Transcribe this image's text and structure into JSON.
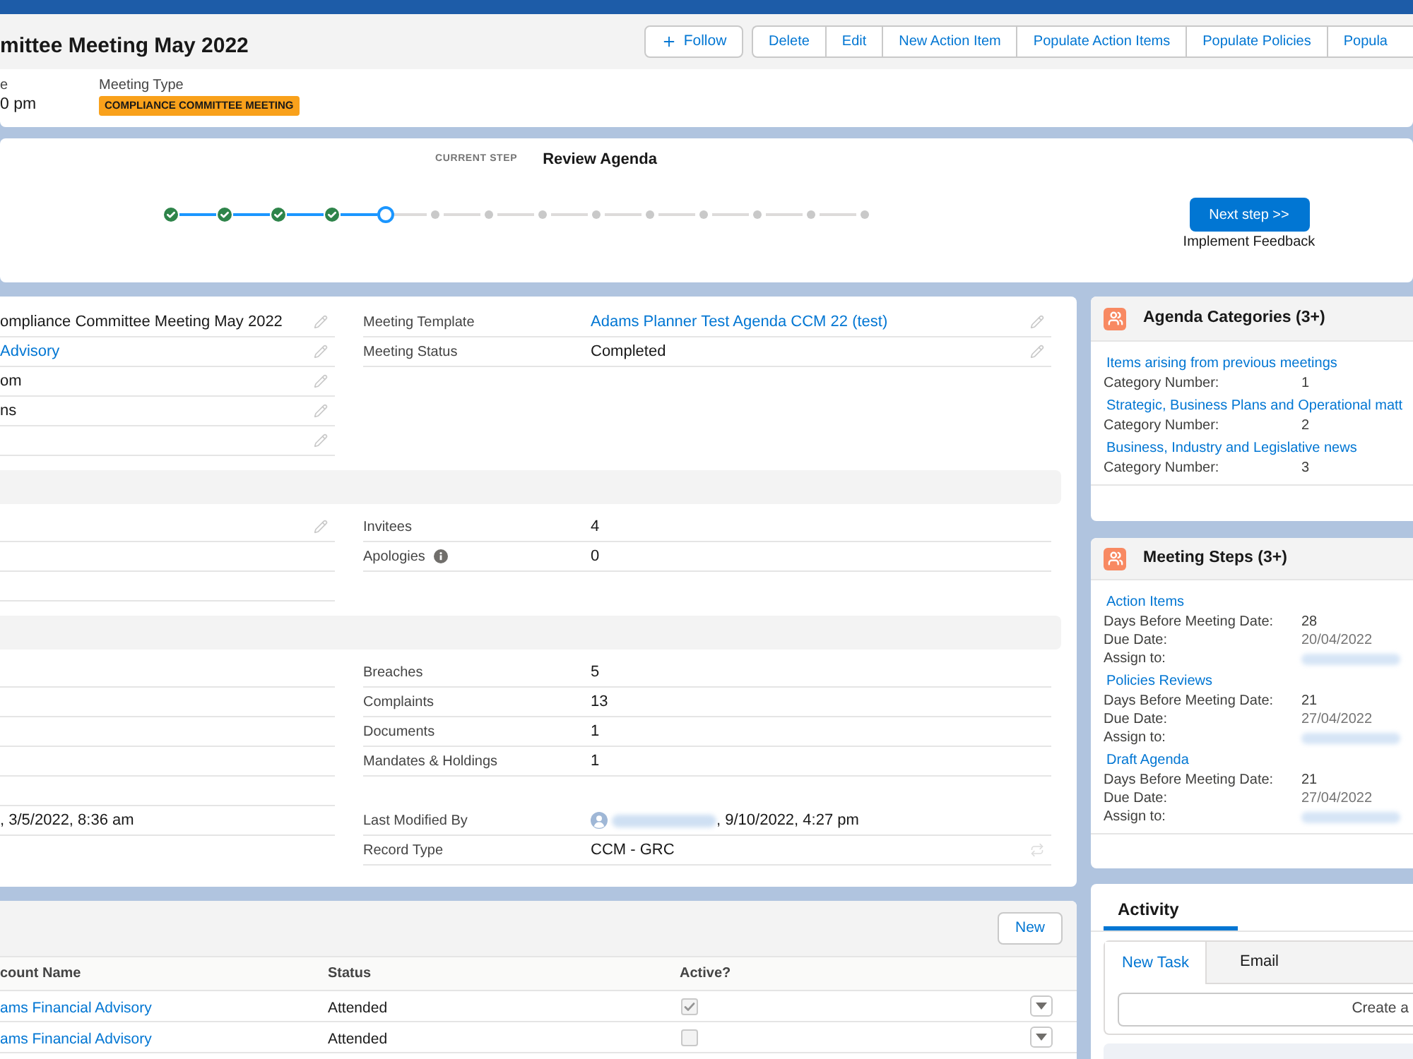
{
  "header": {
    "title": "mittee Meeting May 2022",
    "follow_button": "Follow",
    "action_buttons": [
      "Delete",
      "Edit",
      "New Action Item",
      "Populate Action Items",
      "Populate Policies",
      "Popula"
    ],
    "fields": [
      {
        "label": "e",
        "value": "0 pm",
        "kind": "text"
      },
      {
        "label": "Meeting Type",
        "value": "COMPLIANCE COMMITTEE MEETING",
        "kind": "badge"
      }
    ]
  },
  "path": {
    "current_step_label": "CURRENT STEP",
    "current_step": "Review Agenda",
    "steps": [
      {
        "completed": true,
        "current": false
      },
      {
        "completed": true,
        "current": false
      },
      {
        "completed": true,
        "current": false
      },
      {
        "completed": true,
        "current": false
      },
      {
        "completed": false,
        "current": true
      },
      {
        "completed": false,
        "current": false
      },
      {
        "completed": false,
        "current": false
      },
      {
        "completed": false,
        "current": false
      },
      {
        "completed": false,
        "current": false
      },
      {
        "completed": false,
        "current": false
      },
      {
        "completed": false,
        "current": false
      },
      {
        "completed": false,
        "current": false
      },
      {
        "completed": false,
        "current": false
      },
      {
        "completed": false,
        "current": false
      }
    ],
    "next_button": "Next step >>",
    "next_step": "Implement Feedback"
  },
  "details": {
    "sections": [
      {
        "kind": "block",
        "left": [
          {
            "kind": "text",
            "value": "ompliance Committee Meeting May 2022",
            "editable": true
          },
          {
            "kind": "link",
            "value": "Advisory",
            "editable": true
          },
          {
            "kind": "text",
            "value": "om",
            "editable": true
          },
          {
            "kind": "text",
            "value": "ns",
            "editable": true
          },
          {
            "kind": "empty",
            "editable": true
          }
        ],
        "right": [
          {
            "kind": "link",
            "label": "Meeting Template",
            "value": "Adams Planner Test Agenda CCM 22 (test)",
            "editable": true
          },
          {
            "kind": "text",
            "label": "Meeting Status",
            "value": "Completed",
            "editable": true
          }
        ]
      },
      {
        "kind": "section",
        "left": [
          {
            "kind": "empty",
            "editable": true
          },
          {
            "kind": "empty",
            "editable": false
          },
          {
            "kind": "empty",
            "editable": false
          }
        ],
        "right": [
          {
            "kind": "text",
            "label": "Invitees",
            "value": "4",
            "editable": false
          },
          {
            "kind": "text",
            "label": "Apologies",
            "has_info": true,
            "value": "0",
            "editable": false
          }
        ]
      },
      {
        "kind": "section",
        "left": [
          {
            "kind": "empty",
            "editable": false
          },
          {
            "kind": "empty",
            "editable": false
          },
          {
            "kind": "empty",
            "editable": false
          },
          {
            "kind": "empty",
            "editable": false
          }
        ],
        "right": [
          {
            "kind": "text",
            "label": "Breaches",
            "value": "5",
            "editable": false
          },
          {
            "kind": "text",
            "label": "Complaints",
            "value": "13",
            "editable": false
          },
          {
            "kind": "text",
            "label": "Documents",
            "value": "1",
            "editable": false
          },
          {
            "kind": "text",
            "label": "Mandates & Holdings",
            "value": "1",
            "editable": false
          }
        ]
      },
      {
        "kind": "block",
        "left": [
          {
            "kind": "empty",
            "editable": false
          },
          {
            "kind": "text",
            "value": ", 3/5/2022, 8:36 am",
            "editable": false
          }
        ],
        "right": [
          {
            "kind": "gap"
          },
          {
            "kind": "user",
            "label": "Last Modified By",
            "value": ", 9/10/2022, 4:27 pm",
            "editable": false
          },
          {
            "kind": "recordtype",
            "label": "Record Type",
            "value": "CCM - GRC",
            "editable": false
          }
        ]
      }
    ]
  },
  "related_list": {
    "new_button": "New",
    "columns": [
      "count Name",
      "Status",
      "Active?"
    ],
    "rows": [
      {
        "name": "ams Financial Advisory",
        "status": "Attended",
        "active": true
      },
      {
        "name": "ams Financial Advisory",
        "status": "Attended",
        "active": false
      }
    ]
  },
  "agenda_categories": {
    "title": "Agenda Categories (3+)",
    "items": [
      {
        "title": "Items arising from previous meetings",
        "fields": [
          {
            "label": "Category Number:",
            "value": "1",
            "kind": "text"
          }
        ]
      },
      {
        "title": "Strategic, Business Plans and Operational matt",
        "fields": [
          {
            "label": "Category Number:",
            "value": "2",
            "kind": "text"
          }
        ]
      },
      {
        "title": "Business, Industry and Legislative news",
        "fields": [
          {
            "label": "Category Number:",
            "value": "3",
            "kind": "text"
          }
        ]
      }
    ]
  },
  "meeting_steps": {
    "title": "Meeting Steps (3+)",
    "items": [
      {
        "title": "Action Items",
        "fields": [
          {
            "label": "Days Before Meeting Date:",
            "value": "28",
            "kind": "text"
          },
          {
            "label": "Due Date:",
            "value": "20/04/2022",
            "kind": "muted"
          },
          {
            "label": "Assign to:",
            "kind": "redacted"
          }
        ]
      },
      {
        "title": "Policies Reviews",
        "fields": [
          {
            "label": "Days Before Meeting Date:",
            "value": "21",
            "kind": "text"
          },
          {
            "label": "Due Date:",
            "value": "27/04/2022",
            "kind": "muted"
          },
          {
            "label": "Assign to:",
            "kind": "redacted"
          }
        ]
      },
      {
        "title": "Draft Agenda",
        "fields": [
          {
            "label": "Days Before Meeting Date:",
            "value": "21",
            "kind": "text"
          },
          {
            "label": "Due Date:",
            "value": "27/04/2022",
            "kind": "muted"
          },
          {
            "label": "Assign to:",
            "kind": "redacted"
          }
        ]
      }
    ]
  },
  "activity": {
    "tabs": [
      {
        "label": "Activity",
        "selected": true
      }
    ],
    "composer_tabs": [
      {
        "label": "New Task",
        "selected": true
      },
      {
        "label": "Email",
        "selected": false
      }
    ],
    "create_button": "Create a"
  }
}
